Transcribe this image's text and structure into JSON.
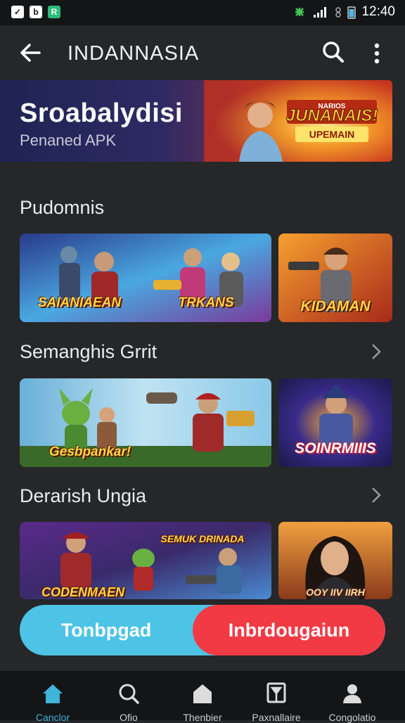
{
  "status_bar": {
    "time": "12:40"
  },
  "app_bar": {
    "title": "INDANNASIA"
  },
  "banner": {
    "title": "Sroabalydisi",
    "subtitle": "Penaned APK",
    "art_title": "JUNANAIS!",
    "art_subtitle": "UPEMAIN",
    "art_top": "NARIOS"
  },
  "sections": [
    {
      "title": "Pudomnis",
      "cards": [
        {
          "label": "SAIANIAEAN"
        },
        {
          "label": "TRKANS"
        },
        {
          "label": "KIDAMAN"
        }
      ]
    },
    {
      "title": "Semanghis Grrit",
      "cards": [
        {
          "label": "Gesbpankar!"
        },
        {
          "label": "SOINRMIIIS"
        }
      ]
    },
    {
      "title": "Derarish Ungia",
      "cards": [
        {
          "label": "CODENMAEN"
        },
        {
          "label": "SEMUK DRINADA"
        },
        {
          "label": "OOY IIV IIRH"
        }
      ]
    }
  ],
  "toggle": {
    "left_label": "Tonbpgad",
    "right_label": "Inbrdougaiun"
  },
  "bottom_nav": [
    {
      "label": "Canclor",
      "icon": "home-icon"
    },
    {
      "label": "Ofio",
      "icon": "search-icon"
    },
    {
      "label": "Thenbier",
      "icon": "house-icon"
    },
    {
      "label": "Paxnallaire",
      "icon": "bookmark-icon"
    },
    {
      "label": "Congolatio",
      "icon": "profile-icon"
    }
  ],
  "colors": {
    "background": "#262729",
    "active_nav": "#3fb3d8",
    "toggle_blue": "#4dc3e6",
    "toggle_red": "#f23a44"
  }
}
